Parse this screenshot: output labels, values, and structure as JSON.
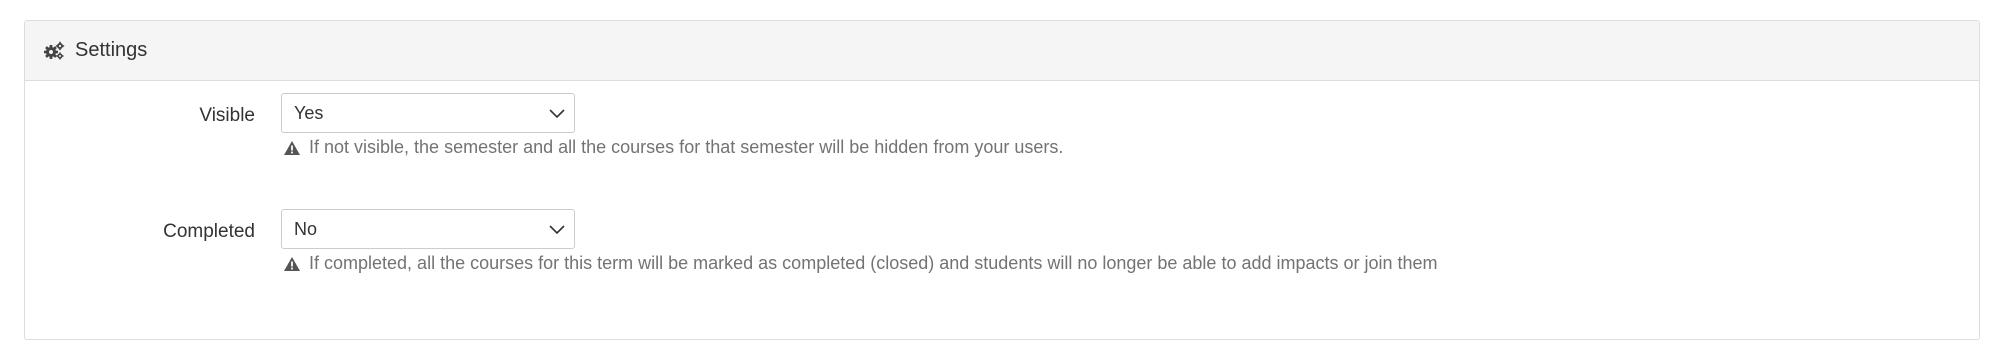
{
  "panel": {
    "title": "Settings",
    "icon": "cogs-icon"
  },
  "fields": {
    "visible": {
      "label": "Visible",
      "value": "Yes",
      "help": "If not visible, the semester and all the courses for that semester will be hidden from your users."
    },
    "completed": {
      "label": "Completed",
      "value": "No",
      "help": "If completed, all the courses for this term will be marked as completed (closed) and students will no longer be able to add impacts or join them"
    }
  },
  "colors": {
    "heading_bg": "#f5f5f5",
    "border": "#dddddd",
    "help_text": "#737373",
    "text": "#333333"
  }
}
